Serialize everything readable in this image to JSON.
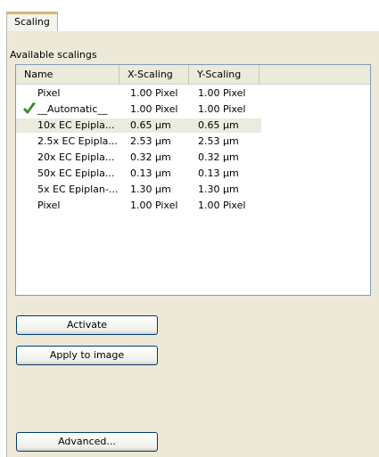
{
  "tab": {
    "label": "Scaling"
  },
  "available_label": "Available scalings",
  "columns": [
    "Name",
    "X-Scaling",
    "Y-Scaling"
  ],
  "rows": [
    {
      "name": "Pixel",
      "x": "1.00 Pixel",
      "y": "1.00 Pixel",
      "active": false,
      "selected": false
    },
    {
      "name": "__Automatic__",
      "x": "1.00 Pixel",
      "y": "1.00 Pixel",
      "active": true,
      "selected": false
    },
    {
      "name": "10x EC Epipla...",
      "x": "0.65 µm",
      "y": "0.65 µm",
      "active": false,
      "selected": true
    },
    {
      "name": "2.5x EC Epipla...",
      "x": "2.53 µm",
      "y": "2.53 µm",
      "active": false,
      "selected": false
    },
    {
      "name": "20x EC Epipla...",
      "x": "0.32 µm",
      "y": "0.32 µm",
      "active": false,
      "selected": false
    },
    {
      "name": "50x EC Epipla...",
      "x": "0.13 µm",
      "y": "0.13 µm",
      "active": false,
      "selected": false
    },
    {
      "name": "5x EC Epiplan-...",
      "x": "1.30 µm",
      "y": "1.30 µm",
      "active": false,
      "selected": false
    },
    {
      "name": "Pixel",
      "x": "1.00 Pixel",
      "y": "1.00 Pixel",
      "active": false,
      "selected": false
    }
  ],
  "buttons": {
    "activate": "Activate",
    "apply": "Apply to image",
    "advanced": "Advanced..."
  },
  "icons": {
    "active_marker": "checkmark-icon"
  },
  "colors": {
    "check": "#2e8b1f",
    "selected_row": "#ecebdf"
  }
}
